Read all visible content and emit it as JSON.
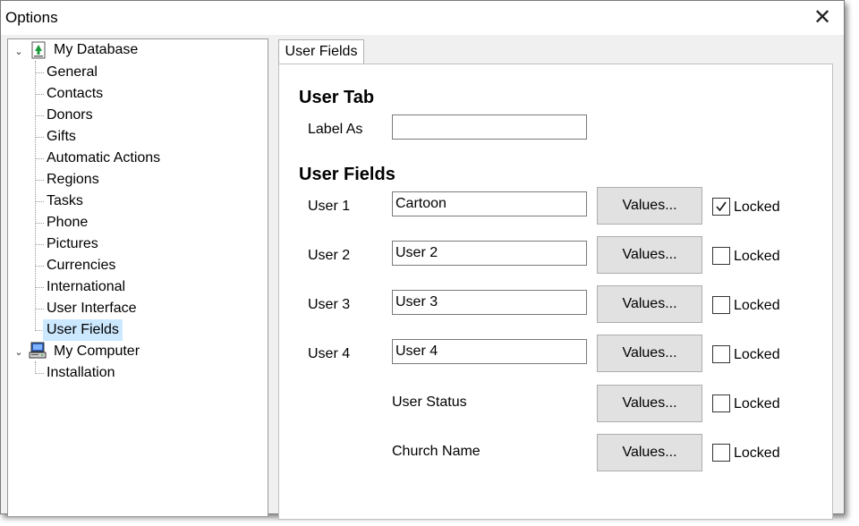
{
  "window": {
    "title": "Options"
  },
  "tree": {
    "root1": {
      "label": "My Database",
      "icon": "database-icon"
    },
    "children1": [
      "General",
      "Contacts",
      "Donors",
      "Gifts",
      "Automatic Actions",
      "Regions",
      "Tasks",
      "Phone",
      "Pictures",
      "Currencies",
      "International",
      "User Interface",
      "User Fields"
    ],
    "selected": "User Fields",
    "root2": {
      "label": "My Computer",
      "icon": "computer-icon"
    },
    "children2": [
      "Installation"
    ]
  },
  "tab": {
    "label": "User Fields"
  },
  "user_tab": {
    "heading": "User Tab",
    "label_as_label": "Label As",
    "label_as_value": ""
  },
  "user_fields": {
    "heading": "User Fields",
    "values_label": "Values...",
    "locked_label": "Locked",
    "rows": [
      {
        "label": "User 1",
        "value": "Cartoon",
        "locked": true
      },
      {
        "label": "User 2",
        "value": "User 2",
        "locked": false
      },
      {
        "label": "User 3",
        "value": "User 3",
        "locked": false
      },
      {
        "label": "User 4",
        "value": "User 4",
        "locked": false
      },
      {
        "label": "User Status",
        "locked": false
      },
      {
        "label": "Church Name",
        "locked": false
      }
    ]
  }
}
